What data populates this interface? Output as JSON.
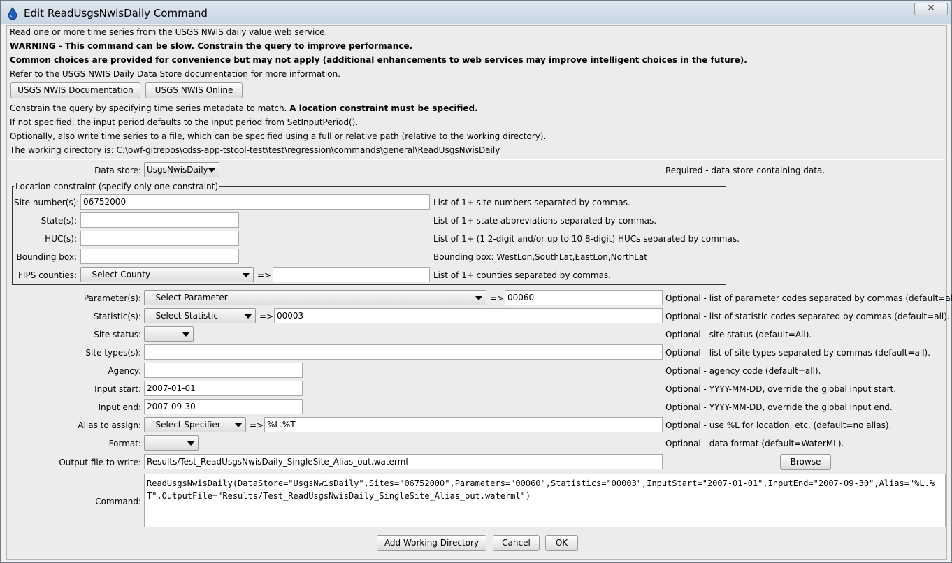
{
  "window": {
    "title": "Edit ReadUsgsNwisDaily Command",
    "close_symbol": "✕"
  },
  "info": {
    "line1": "Read one or more time series from the USGS NWIS daily value web service.",
    "line2": "WARNING - This command can be slow. Constrain the query to improve performance.",
    "line3": "Common choices are provided for convenience but may not apply (additional enhancements to web services may improve intelligent choices in the future).",
    "line4": "Refer to the USGS NWIS Daily Data Store documentation for more information.",
    "line5_normal": "Constrain the query by specifying time series metadata to match. ",
    "line5_bold": "A location constraint must be specified.",
    "line6": "If not specified, the input period defaults to the input period from SetInputPeriod().",
    "line7": "Optionally, also write time series to a file, which can be specified using a full or relative path (relative to the working directory).",
    "line8": "The working directory is: C:\\owf-gitrepos\\cdss-app-tstool-test\\test\\regression\\commands\\general\\ReadUsgsNwisDaily"
  },
  "doc_buttons": {
    "documentation": "USGS NWIS Documentation",
    "online": "USGS NWIS Online"
  },
  "datastore": {
    "label": "Data store:",
    "value": "UsgsNwisDaily",
    "note": "Required - data store containing data."
  },
  "location": {
    "legend": "Location constraint (specify only one constraint)",
    "site_label": "Site number(s):",
    "site_value": "06752000",
    "site_note": "List of 1+ site numbers separated by commas.",
    "state_label": "State(s):",
    "state_value": "",
    "state_note": "List of 1+ state abbreviations separated by commas.",
    "huc_label": "HUC(s):",
    "huc_value": "",
    "huc_note": "List of 1+ (1 2-digit and/or up to 10 8-digit) HUCs separated by commas.",
    "bbox_label": "Bounding box:",
    "bbox_value": "",
    "bbox_note": "Bounding box: WestLon,SouthLat,EastLon,NorthLat",
    "fips_label": "FIPS counties:",
    "fips_select": "-- Select County --",
    "fips_value": "",
    "fips_note": "List of 1+ counties separated by commas."
  },
  "arrow": "=>",
  "params": {
    "parameter_label": "Parameter(s):",
    "parameter_select": "-- Select Parameter --",
    "parameter_value": "00060",
    "parameter_note": "Optional - list of parameter codes separated by commas (default=all).",
    "statistic_label": "Statistic(s):",
    "statistic_select": "-- Select Statistic --",
    "statistic_value": "00003",
    "statistic_note": "Optional - list of statistic codes separated by commas (default=all).",
    "site_status_label": "Site status:",
    "site_status_value": "",
    "site_status_note": "Optional - site status (default=All).",
    "site_types_label": "Site types(s):",
    "site_types_value": "",
    "site_types_note": "Optional - list of site types separated by commas (default=all).",
    "agency_label": "Agency:",
    "agency_value": "",
    "agency_note": "Optional - agency code (default=all).",
    "input_start_label": "Input start:",
    "input_start_value": "2007-01-01",
    "input_start_note": "Optional - YYYY-MM-DD, override the global input start.",
    "input_end_label": "Input end:",
    "input_end_value": "2007-09-30",
    "input_end_note": "Optional - YYYY-MM-DD, override the global input end.",
    "alias_label": "Alias to assign:",
    "alias_select": "-- Select Specifier --",
    "alias_value": "%L.%T",
    "alias_note": "Optional - use %L for location, etc. (default=no alias).",
    "format_label": "Format:",
    "format_value": "",
    "format_note": "Optional - data format (default=WaterML).",
    "output_label": "Output file to write:",
    "output_value": "Results/Test_ReadUsgsNwisDaily_SingleSite_Alias_out.waterml",
    "browse": "Browse",
    "command_label": "Command:",
    "command_value": "ReadUsgsNwisDaily(DataStore=\"UsgsNwisDaily\",Sites=\"06752000\",Parameters=\"00060\",Statistics=\"00003\",InputStart=\"2007-01-01\",InputEnd=\"2007-09-30\",Alias=\"%L.%T\",OutputFile=\"Results/Test_ReadUsgsNwisDaily_SingleSite_Alias_out.waterml\")"
  },
  "footer": {
    "add_wd": "Add Working Directory",
    "cancel": "Cancel",
    "ok": "OK"
  }
}
